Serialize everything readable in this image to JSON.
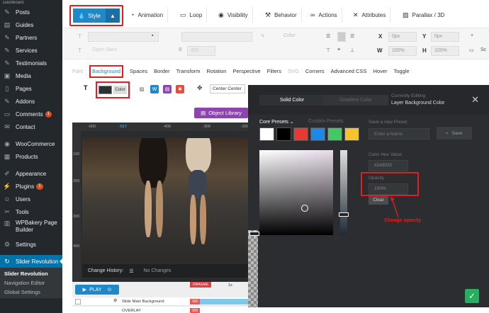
{
  "sidebar": {
    "dashboard": "Dashboard",
    "items": [
      {
        "label": "Posts",
        "icon": "pin-icon"
      },
      {
        "label": "Guides",
        "icon": "book-icon"
      },
      {
        "label": "Partners",
        "icon": "pin-icon"
      },
      {
        "label": "Services",
        "icon": "pin-icon"
      },
      {
        "label": "Testimonials",
        "icon": "pin-icon"
      },
      {
        "label": "Media",
        "icon": "media-icon"
      },
      {
        "label": "Pages",
        "icon": "page-icon"
      },
      {
        "label": "Addons",
        "icon": "pin-icon"
      },
      {
        "label": "Comments",
        "icon": "comment-icon",
        "badge": "1"
      },
      {
        "label": "Contact",
        "icon": "mail-icon"
      },
      {
        "label": "WooCommerce",
        "icon": "woo-icon"
      },
      {
        "label": "Products",
        "icon": "box-icon"
      },
      {
        "label": "Appearance",
        "icon": "brush-icon"
      },
      {
        "label": "Plugins",
        "icon": "plug-icon",
        "badge": "1"
      },
      {
        "label": "Users",
        "icon": "user-icon"
      },
      {
        "label": "Tools",
        "icon": "wrench-icon"
      },
      {
        "label": "WPBakery Page Builder",
        "icon": "builder-icon"
      },
      {
        "label": "Settings",
        "icon": "settings-icon"
      },
      {
        "label": "Slider Revolution",
        "icon": "refresh-icon"
      }
    ],
    "submenu": [
      "Slider Revolution",
      "Navigation Editor",
      "Global Settings"
    ]
  },
  "toolbar": {
    "style": "Style",
    "tabs": [
      "Animation",
      "Loop",
      "Visibility",
      "Behavior",
      "Actions",
      "Attributes",
      "Parallax / 3D"
    ]
  },
  "tool_rows": {
    "row1": {
      "color_label": "Color",
      "x_value": "0px",
      "y_value": "0px",
      "x_label": "X",
      "y_label": "Y"
    },
    "row2": {
      "font": "Open Sans",
      "weight": "400",
      "w_value": "100%",
      "h_value": "100%",
      "w_label": "W",
      "h_label": "H",
      "sc": "Sc"
    }
  },
  "subtabs": [
    "Font",
    "Background",
    "Spaces",
    "Border",
    "Transform",
    "Rotation",
    "Perspective",
    "Filters",
    "SVG",
    "Corners",
    "Advanced CSS",
    "Hover",
    "Toggle"
  ],
  "background": {
    "color_label": "Color",
    "position": "Center Center",
    "swatch_color": "#2d3032"
  },
  "object_library": "Object Library",
  "canvas": {
    "ruler_top": [
      "-600",
      "-517",
      "-400",
      "-300",
      "-200"
    ],
    "ruler_left": [
      "100",
      "200",
      "300",
      "400"
    ],
    "change_history": "Change History:",
    "no_changes": "No Changes"
  },
  "timeline": {
    "play": "PLAY",
    "dragme": "DRAGME",
    "time": "1s",
    "rows": [
      {
        "name": "Slide Main Background",
        "badge": "300"
      },
      {
        "name": "OVERLAY",
        "badge": "300"
      }
    ]
  },
  "color_panel": {
    "tab_solid": "Solid Color",
    "tab_gradient": "Gradient Color",
    "currently_editing": "Currently Editing",
    "editing_target": "Layer Background Color",
    "core_presets": "Core Presets",
    "custom_presets": "Custom Presets",
    "save_new_preset": "Save a new Preset",
    "enter_name_placeholder": "Enter a Name",
    "save": "Save",
    "hex_label": "Color Hex Value",
    "hex_value": "#2d3032",
    "opacity_label": "Opacity",
    "opacity_value": "100%",
    "clear": "Clear",
    "annotation": "Chnage opacity",
    "preset_colors": [
      "#ffffff",
      "#000000",
      "#e53935",
      "#1e88e5",
      "#43c865",
      "#f4c430"
    ]
  },
  "colors": {
    "accent": "#1e88c8",
    "highlight": "#e02020",
    "panel": "#2b2d30"
  }
}
